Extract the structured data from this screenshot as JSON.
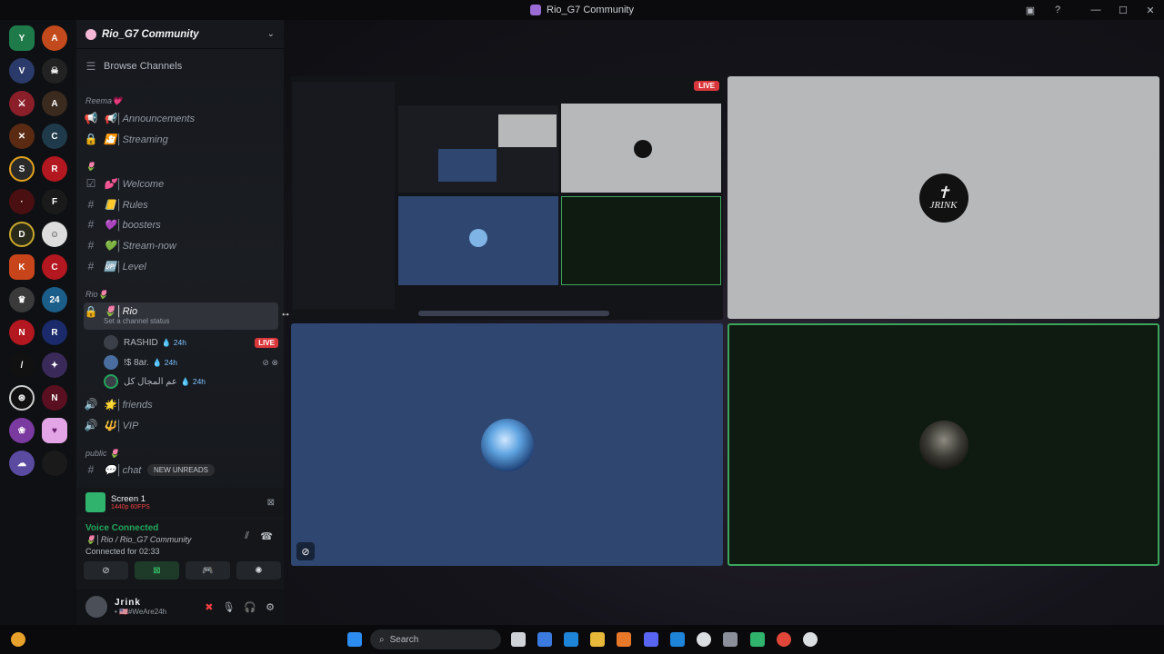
{
  "window": {
    "title": "Rio_G7 Community",
    "controls": [
      "▣",
      "?",
      "—",
      "☐",
      "✕"
    ]
  },
  "server": {
    "name": "Rio_G7 Community",
    "browse_label": "Browse Channels"
  },
  "categories": {
    "reema": "Reema💗",
    "heart": "🌷",
    "rio": "Rio🌷",
    "public": "public 🌷"
  },
  "channels": {
    "announcements": "📢│Announcements",
    "streaming": "🎦│Streaming",
    "welcome": "💕│Welcome",
    "rules": "📒│Rules",
    "boosters": "💜│boosters",
    "stream_now": "💚│Stream-now",
    "level": "🆙│Level",
    "rio": "🌷│Rio",
    "rio_status": "Set a channel status",
    "friends": "🌟│friends",
    "vip": "🔱│VIP",
    "chat": "💬│chat"
  },
  "voice_users": [
    {
      "name": "RASHID",
      "badge": "💧 24h",
      "live": "LIVE"
    },
    {
      "name": "!$ 8ar.",
      "badge": "💧 24h"
    },
    {
      "name": "عم المجال كل",
      "badge": "💧 24h"
    }
  ],
  "new_unreads": "NEW UNREADS",
  "stream_panel": {
    "title": "Screen 1",
    "sub": "1440p 60FPS"
  },
  "voice": {
    "status": "Voice Connected",
    "channel": "🌷│Rio / Rio_G7 Community",
    "time": "Connected for 02:33"
  },
  "user": {
    "name": "Jrink",
    "status": "• 🇺🇸#WeAre24h"
  },
  "tiles": {
    "live": "LIVE",
    "logo_text": "JRINK"
  },
  "taskbar": {
    "search": "Search"
  },
  "colors": {
    "accent_green": "#23a55a",
    "live_red": "#da373c",
    "tile_blue": "#2e4670"
  }
}
